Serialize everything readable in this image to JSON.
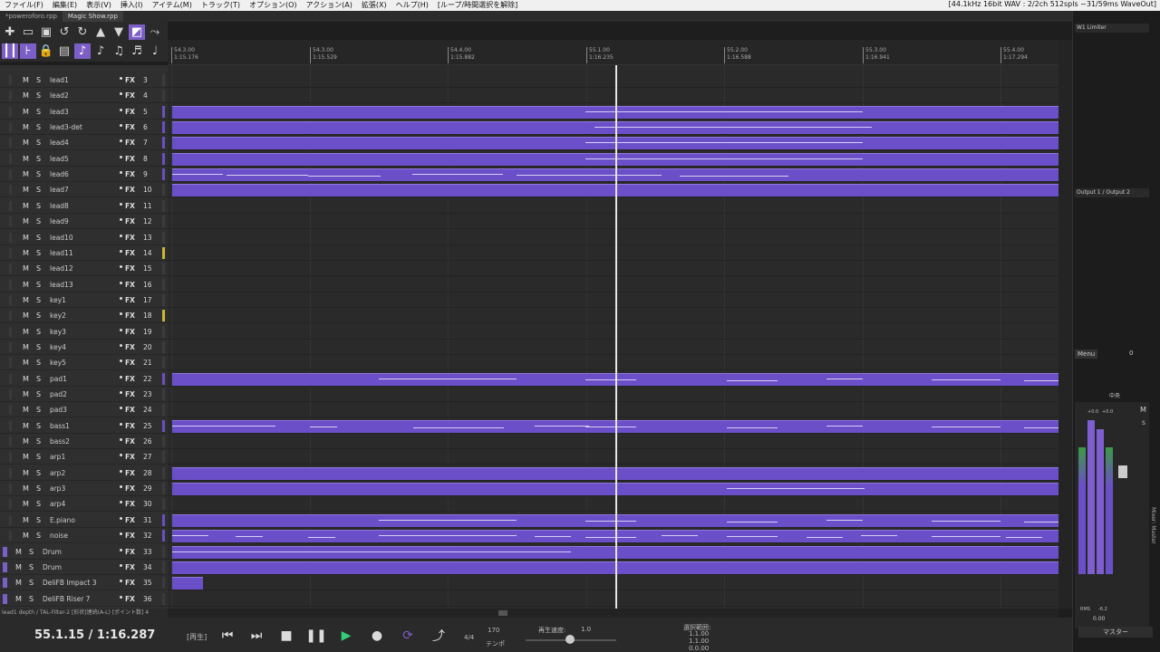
{
  "menu": [
    "ファイル(F)",
    "編集(E)",
    "表示(V)",
    "挿入(I)",
    "アイテム(M)",
    "トラック(T)",
    "オプション(O)",
    "アクション(A)",
    "拡張(X)",
    "ヘルプ(H)",
    "[ループ/時間選択を解除]"
  ],
  "status_right": "[44.1kHz 16bit WAV : 2/2ch 512spls ~31/59ms WaveOut]",
  "project_tabs": [
    "*poweroforo.rpp",
    "Magic Show.rpp"
  ],
  "ruler": {
    "marks": [
      {
        "bar": "54.3.00",
        "time": "1:15.176"
      },
      {
        "bar": "54.3.00",
        "time": "1:15.529"
      },
      {
        "bar": "54.4.00",
        "time": "1:15.882"
      },
      {
        "bar": "55.1.00",
        "time": "1:16.235"
      },
      {
        "bar": "55.2.00",
        "time": "1:16.588"
      },
      {
        "bar": "55.3.00",
        "time": "1:16.941"
      },
      {
        "bar": "55.4.00",
        "time": "1:17.294"
      }
    ]
  },
  "tracks": [
    {
      "name": "lead1",
      "num": "3"
    },
    {
      "name": "lead2",
      "num": "4"
    },
    {
      "name": "lead3",
      "num": "5"
    },
    {
      "name": "lead3-det",
      "num": "6"
    },
    {
      "name": "lead4",
      "num": "7"
    },
    {
      "name": "lead5",
      "num": "8"
    },
    {
      "name": "lead6",
      "num": "9"
    },
    {
      "name": "lead7",
      "num": "10"
    },
    {
      "name": "lead8",
      "num": "11"
    },
    {
      "name": "lead9",
      "num": "12"
    },
    {
      "name": "lead10",
      "num": "13"
    },
    {
      "name": "lead11",
      "num": "14"
    },
    {
      "name": "lead12",
      "num": "15"
    },
    {
      "name": "lead13",
      "num": "16"
    },
    {
      "name": "key1",
      "num": "17"
    },
    {
      "name": "key2",
      "num": "18"
    },
    {
      "name": "key3",
      "num": "19"
    },
    {
      "name": "key4",
      "num": "20"
    },
    {
      "name": "key5",
      "num": "21"
    },
    {
      "name": "pad1",
      "num": "22"
    },
    {
      "name": "pad2",
      "num": "23"
    },
    {
      "name": "pad3",
      "num": "24"
    },
    {
      "name": "bass1",
      "num": "25"
    },
    {
      "name": "bass2",
      "num": "26"
    },
    {
      "name": "arp1",
      "num": "27"
    },
    {
      "name": "arp2",
      "num": "28"
    },
    {
      "name": "arp3",
      "num": "29"
    },
    {
      "name": "arp4",
      "num": "30"
    },
    {
      "name": "E.piano",
      "num": "31"
    },
    {
      "name": "noise",
      "num": "32"
    },
    {
      "name": "Drum",
      "num": "33"
    },
    {
      "name": "Drum",
      "num": "34"
    },
    {
      "name": "DeliFB Impact 3",
      "num": "35"
    },
    {
      "name": "DeliFB Riser 7",
      "num": "36"
    }
  ],
  "track_labels": {
    "mute": "M",
    "solo": "S",
    "fx": "FX"
  },
  "statusbar": "lead1 depth / TAL-Filter-2 [形状]連続(A-L) [ポイント数] 4",
  "transport": {
    "timecode": "55.1.15 / 1:16.287",
    "state_label": "[再生]",
    "time_sig": "4/4",
    "bpm": "170",
    "bpm_label": "テンポ",
    "rate_label": "再生速度:",
    "rate_value": "1.0",
    "selection_label": "選択範囲:",
    "selection_start": "1.1.00",
    "selection_end": "1.1.00",
    "selection_len": "0.0.00"
  },
  "mixer": {
    "fx1": "W1 Limiter",
    "io": "Output 1 / Output 2",
    "menu": "Menu",
    "zero": "0",
    "pan_label": "中央",
    "vol_db_l": "+0.0",
    "vol_db_r": "+0.0",
    "rms_label": "RMS",
    "rms_value": "-6.2",
    "vol_value": "0.00",
    "name": "マスター",
    "master_label": "Mixer: Master"
  }
}
